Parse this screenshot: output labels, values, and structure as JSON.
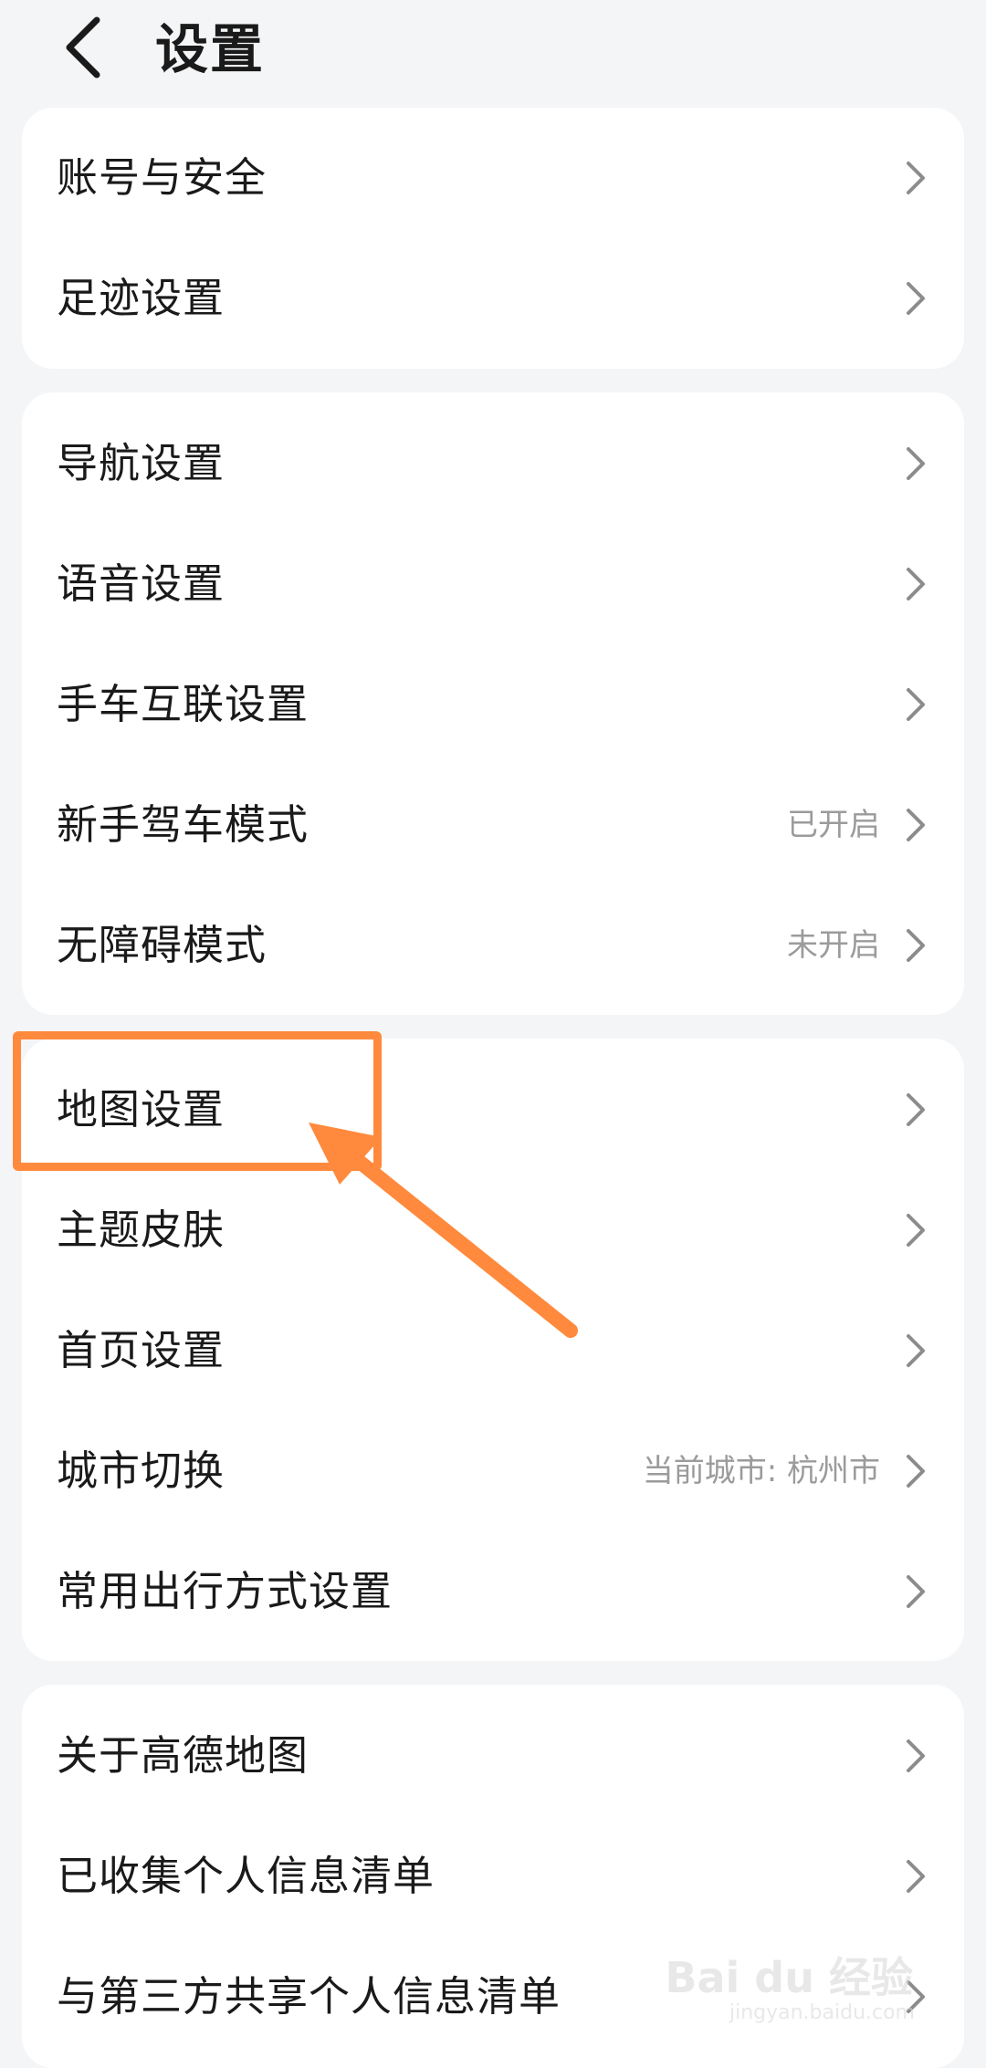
{
  "header": {
    "title": "设置",
    "back_icon": "back-chevron-icon"
  },
  "groups": [
    {
      "rows": [
        {
          "label": "账号与安全",
          "value": ""
        },
        {
          "label": "足迹设置",
          "value": ""
        }
      ]
    },
    {
      "rows": [
        {
          "label": "导航设置",
          "value": ""
        },
        {
          "label": "语音设置",
          "value": ""
        },
        {
          "label": "手车互联设置",
          "value": ""
        },
        {
          "label": "新手驾车模式",
          "value": "已开启"
        },
        {
          "label": "无障碍模式",
          "value": "未开启"
        }
      ]
    },
    {
      "rows": [
        {
          "label": "地图设置",
          "value": ""
        },
        {
          "label": "主题皮肤",
          "value": ""
        },
        {
          "label": "首页设置",
          "value": ""
        },
        {
          "label": "城市切换",
          "value": "当前城市: 杭州市"
        },
        {
          "label": "常用出行方式设置",
          "value": ""
        }
      ]
    },
    {
      "rows": [
        {
          "label": "关于高德地图",
          "value": ""
        },
        {
          "label": "已收集个人信息清单",
          "value": ""
        },
        {
          "label": "与第三方共享个人信息清单",
          "value": ""
        }
      ]
    }
  ],
  "annotation": {
    "color": "#ff8a3d",
    "target": "地图设置"
  },
  "watermark": {
    "text": "Bai du 经验",
    "sub": "jingyan.baidu.com"
  },
  "colors": {
    "background": "#f4f5f7",
    "card": "#ffffff",
    "text": "#1a1a1a",
    "secondary": "#9b9b9b",
    "highlight": "#ff8a3d"
  }
}
